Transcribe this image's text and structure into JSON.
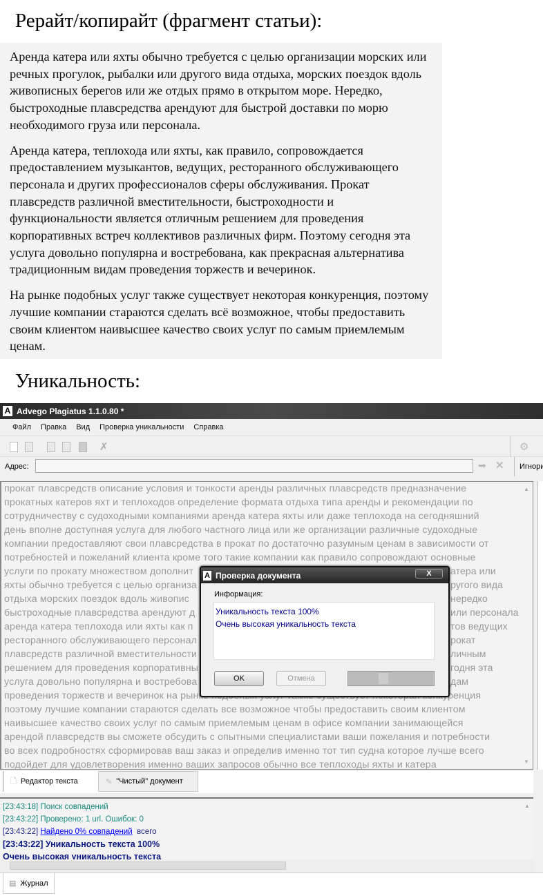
{
  "heading_rewrite": "Рерайт/копирайт (фрагмент статьи):",
  "article": [
    "Аренда катера или яхты обычно требуется с целью организации морских или речных прогулок, рыбалки или другого вида отдыха, морских поездок вдоль живописных берегов или же отдых прямо в открытом море. Нередко, быстроходные плавсредства арендуют для быстрой доставки по морю необходимого груза или персонала.",
    "Аренда катера, теплохода или яхты, как правило, сопровождается предоставлением музыкантов, ведущих, ресторанного обслуживающего персонала и других профессионалов сферы обслуживания. Прокат плавсредств различной вместительности, быстроходности и функциональности является отличным решением для проведения корпоративных встреч коллективов различных фирм. Поэтому сегодня эта услуга довольно популярна и востребована, как прекрасная альтернатива традиционным видам проведения торжеств и вечеринок.",
    "На рынке подобных услуг также существует некоторая конкуренция, поэтому лучшие компании стараются сделать всё возможное, чтобы предоставить своим клиентом наивысшее качество своих услуг по самым приемлемым ценам."
  ],
  "heading_unique": "Уникальность:",
  "app": {
    "title": "Advego Plagiatus 1.1.0.80 *",
    "menu": [
      "Файл",
      "Правка",
      "Вид",
      "Проверка уникальности",
      "Справка"
    ],
    "address_label": "Адрес:",
    "address_value": "",
    "ignore_label": "Игнори",
    "editor_lines": [
      {
        "l": "прокат плавсредств описание условия и тонкости аренды различных плавсредств предназначение"
      },
      {
        "l": "прокатных катеров яхт и теплоходов определение формата отдыха типа аренды и рекомендации по"
      },
      {
        "l": "сотрудничеству с судоходными компаниями аренда катера яхты или даже теплохода на сегодняшний"
      },
      {
        "l": "день вполне доступная услуга для любого частного лица или же организации различные судоходные"
      },
      {
        "l": "компании предоставляют свои плавсредства в прокат по достаточно разумным ценам в зависимости от"
      },
      {
        "l": "потребностей и пожеланий клиента кроме того такие компании как правило сопровождают основные"
      },
      {
        "l": "услуги по прокату множеством дополнит",
        "r": "атера или"
      },
      {
        "l": "яхты обычно требуется с целью организа",
        "r": "ругого вида"
      },
      {
        "l": "отдыха морских поездок вдоль живопис",
        "r": "нередко"
      },
      {
        "l": "быстроходные плавсредства арендуют д",
        "r": "или персонала"
      },
      {
        "l": "аренда катера теплохода или яхты как п",
        "r": "тов ведущих"
      },
      {
        "l": "ресторанного обслуживающего персонал",
        "r": "рокат"
      },
      {
        "l": "плавсредств различной вместительности",
        "r": "личным"
      },
      {
        "l": "решением для проведения корпоративны",
        "r": "годня эта"
      },
      {
        "l": "услуга довольно популярна и востребова",
        "r": "дам"
      },
      {
        "l": "проведения торжеств и вечеринок на рынке подобных услуг также существует некоторая конкуренция"
      },
      {
        "l": "поэтому лучшие компании стараются сделать все возможное чтобы предоставить своим клиентом"
      },
      {
        "l": "наивысшее качество своих услуг по самым приемлемым ценам в офисе компании занимающейся"
      },
      {
        "l": "арендой плавсредств вы сможете обсудить с опытными специалистами ваши пожелания и потребности"
      },
      {
        "l": "во всех подробностях сформировав ваш заказ и определив именно тот тип судна которое лучше всего"
      },
      {
        "l": "подойдет для удовлетворения именно ваших запросов обычно все теплоходы яхты и катера"
      }
    ],
    "tabs": [
      "Редактор текста",
      "\"Чистый\" документ"
    ],
    "log": {
      "l1_time": "[23:43:18]",
      "l1_text": "Поиск совпадений",
      "l2_time": "[23:43:22]",
      "l2_text": "Проверено: 1 url. Ошибок: 0",
      "l3_time": "[23:43:22]",
      "l3_link": "Найдено 0% совпадений",
      "l3_text": "всего",
      "l4": "[23:43:22] Уникальность текста 100%",
      "l5": "Очень высокая уникальность текста"
    },
    "bottom_tab": "Журнал"
  },
  "dialog": {
    "title": "Проверка документа",
    "info_label": "Информация:",
    "line1": "Уникальность текста 100%",
    "line2": "Очень высокая уникальность текста",
    "ok": "OK",
    "cancel": "Отмена",
    "close": "X"
  }
}
